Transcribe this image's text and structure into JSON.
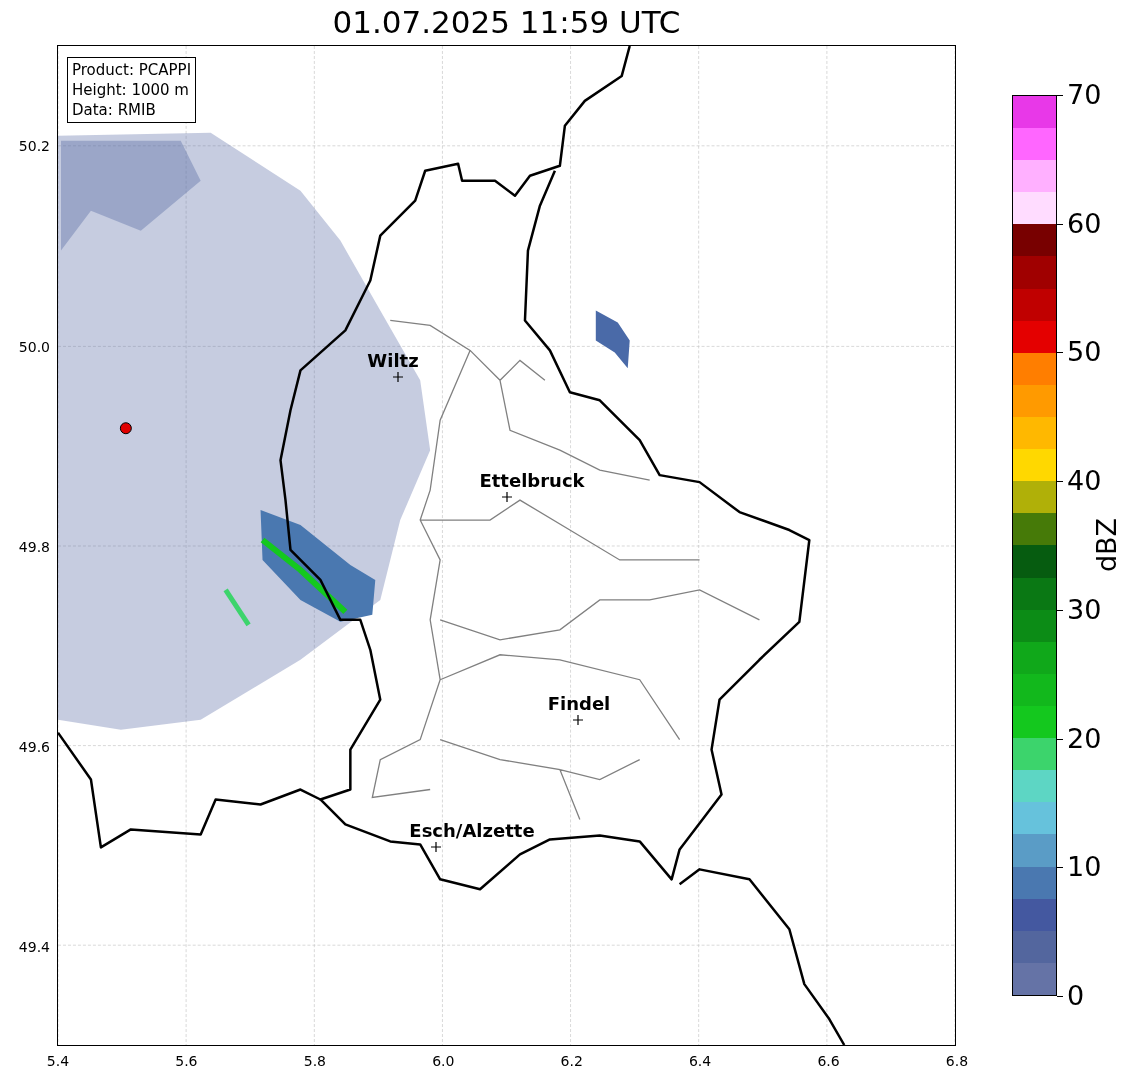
{
  "title": "01.07.2025 11:59 UTC",
  "info_box": [
    "Product: PCAPPI",
    "Height: 1000 m",
    "Data: RMIB"
  ],
  "map": {
    "cities": [
      {
        "name": "Wiltz"
      },
      {
        "name": "Ettelbruck"
      },
      {
        "name": "Findel"
      },
      {
        "name": "Esch/Alzette"
      }
    ],
    "y_ticks": [
      "50.2",
      "50.0",
      "49.8",
      "49.6",
      "49.4"
    ],
    "x_ticks": [
      "5.4",
      "5.6",
      "5.8",
      "6.0",
      "6.2",
      "6.4",
      "6.6",
      "6.8"
    ]
  },
  "colorbar": {
    "label": "dBZ",
    "ticks": [
      "70",
      "60",
      "50",
      "40",
      "30",
      "20",
      "10",
      "0"
    ],
    "bands": [
      {
        "color": "#6573a6"
      },
      {
        "color": "#53669e"
      },
      {
        "color": "#4458a0"
      },
      {
        "color": "#4a78b0"
      },
      {
        "color": "#5a9cc6"
      },
      {
        "color": "#66c2dc"
      },
      {
        "color": "#5dd6c4"
      },
      {
        "color": "#3cd46c"
      },
      {
        "color": "#14c81e"
      },
      {
        "color": "#12b81c"
      },
      {
        "color": "#10a81a"
      },
      {
        "color": "#0c8c16"
      },
      {
        "color": "#0a7814"
      },
      {
        "color": "#065c10"
      },
      {
        "color": "#467a08"
      },
      {
        "color": "#b0b008"
      },
      {
        "color": "#ffd800"
      },
      {
        "color": "#ffb800"
      },
      {
        "color": "#ff9a00"
      },
      {
        "color": "#ff7e00"
      },
      {
        "color": "#e40000"
      },
      {
        "color": "#c00000"
      },
      {
        "color": "#a00000"
      },
      {
        "color": "#780000"
      },
      {
        "color": "#ffdcff"
      },
      {
        "color": "#ffb0ff"
      },
      {
        "color": "#ff66ff"
      },
      {
        "color": "#e838e8"
      }
    ]
  }
}
